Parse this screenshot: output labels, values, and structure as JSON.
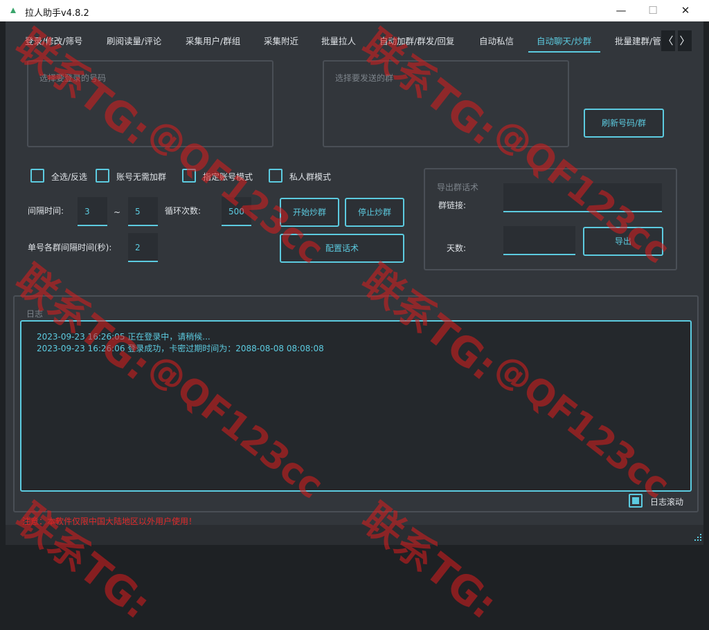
{
  "window": {
    "title": "拉人助手v4.8.2",
    "minimize_glyph": "—",
    "maximize_glyph": "☐",
    "close_glyph": "✕"
  },
  "tabs": [
    {
      "label": "登录/修改/筛号"
    },
    {
      "label": "刷阅读量/评论"
    },
    {
      "label": "采集用户/群组"
    },
    {
      "label": "采集附近"
    },
    {
      "label": "批量拉人"
    },
    {
      "label": "自动加群/群发/回复"
    },
    {
      "label": "自动私信"
    },
    {
      "label": "自动聊天/炒群"
    },
    {
      "label": "批量建群/管"
    }
  ],
  "active_tab": "自动聊天/炒群",
  "tab_scroll": {
    "left": "〈",
    "right": "〉"
  },
  "accounts_panel": {
    "placeholder": "选择要登录的号码"
  },
  "groups_panel": {
    "placeholder": "选择要发送的群"
  },
  "refresh_button": "刷新号码/群",
  "checkboxes": [
    {
      "label": "全选/反选"
    },
    {
      "label": "账号无需加群"
    },
    {
      "label": "指定账号模式"
    },
    {
      "label": "私人群模式"
    }
  ],
  "interval": {
    "label": "间隔时间:",
    "min": "3",
    "separator": "~",
    "max": "5"
  },
  "loop": {
    "label": "循环次数:",
    "value": "500"
  },
  "per_group_interval": {
    "label": "单号各群间隔时间(秒):",
    "value": "2"
  },
  "buttons": {
    "start": "开始炒群",
    "stop": "停止炒群",
    "config": "配置话术"
  },
  "export": {
    "title": "导出群话术",
    "link_label": "群链接:",
    "link_value": "",
    "days_label": "天数:",
    "days_value": "",
    "button": "导出"
  },
  "log": {
    "title": "日志",
    "lines": [
      "2023-09-23 16:26:05 正在登录中，请稍候...",
      "2023-09-23 16:26:06 登录成功，卡密过期时间为：2088-08-08 08:08:08"
    ],
    "autoscroll_label": "日志滚动",
    "autoscroll_checked": true
  },
  "notice": "注意：本软件仅限中国大陆地区以外用户使用！",
  "watermark": {
    "line1": "联系TG:",
    "line2": "@QF123cc"
  },
  "colors": {
    "accent": "#5ccbe0",
    "background": "#32363b",
    "notice": "#e02a2a",
    "watermark": "#dc1e1e"
  }
}
